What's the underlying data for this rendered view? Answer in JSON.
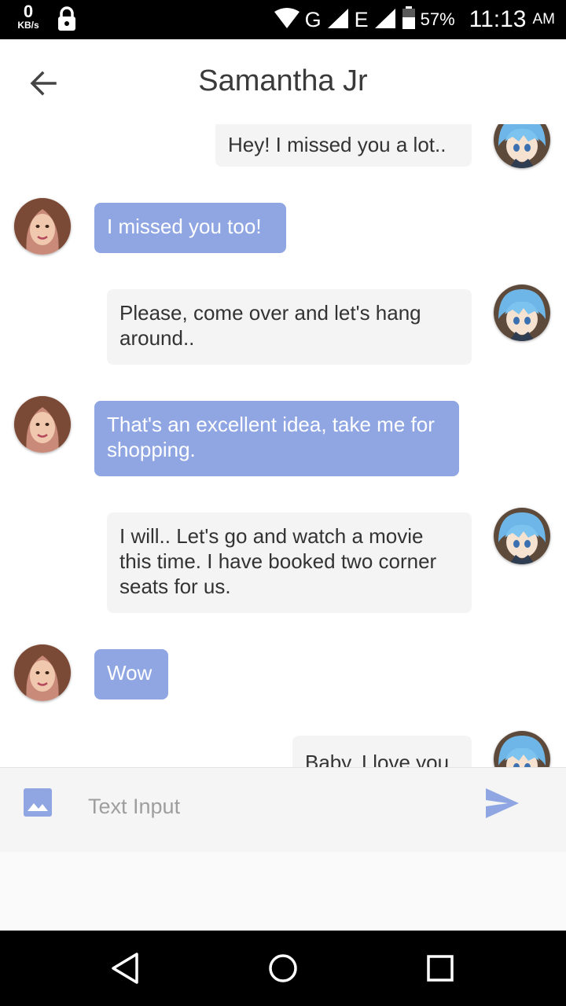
{
  "status_bar": {
    "net_speed": "0",
    "net_unit": "KB/s",
    "network_g": "G",
    "network_e": "E",
    "battery": "57%",
    "time": "11:13",
    "ampm": "AM"
  },
  "header": {
    "title": "Samantha Jr"
  },
  "messages": [
    {
      "side": "out",
      "text": "Hey! I missed you a lot.."
    },
    {
      "side": "in",
      "text": "I missed you too!"
    },
    {
      "side": "out",
      "text": "Please, come over and let's hang around.."
    },
    {
      "side": "in",
      "text": "That's an excellent idea, take me for shopping."
    },
    {
      "side": "out",
      "text": "I will.. Let's go and watch a movie this time. I have booked two corner seats for us."
    },
    {
      "side": "in",
      "text": "Wow"
    },
    {
      "side": "out",
      "text": "Baby, I love you."
    }
  ],
  "composer": {
    "placeholder": "Text Input"
  },
  "icons": {
    "back": "arrow-left-icon",
    "attach": "image-icon",
    "send": "send-icon",
    "nav_back": "triangle-back-icon",
    "nav_home": "circle-home-icon",
    "nav_recent": "square-recents-icon"
  },
  "colors": {
    "incoming_bubble": "#8fa6e3",
    "outgoing_bubble": "#f4f4f4",
    "accent": "#8fa6e3"
  }
}
